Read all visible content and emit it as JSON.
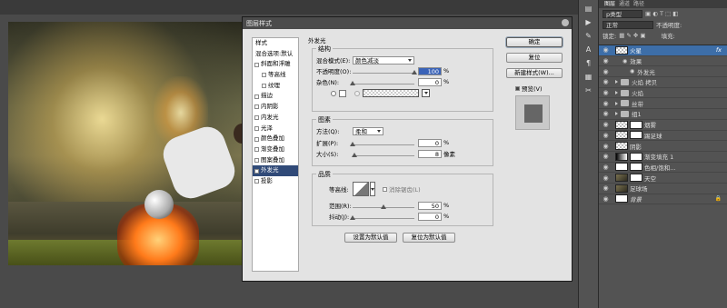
{
  "dialog": {
    "title": "图层样式",
    "styles_list": [
      {
        "label": "样式",
        "kind": "hdr"
      },
      {
        "label": "混合选项:默认",
        "kind": "hdr"
      },
      {
        "label": "斜面和浮雕",
        "kind": "cb"
      },
      {
        "label": "等高线",
        "kind": "sub"
      },
      {
        "label": "纹理",
        "kind": "sub"
      },
      {
        "label": "描边",
        "kind": "cb"
      },
      {
        "label": "内阴影",
        "kind": "cb"
      },
      {
        "label": "内发光",
        "kind": "cb"
      },
      {
        "label": "光泽",
        "kind": "cb"
      },
      {
        "label": "颜色叠加",
        "kind": "cb"
      },
      {
        "label": "渐变叠加",
        "kind": "cb"
      },
      {
        "label": "图案叠加",
        "kind": "cb"
      },
      {
        "label": "外发光",
        "kind": "sel"
      },
      {
        "label": "投影",
        "kind": "cb"
      }
    ],
    "outer_glow_title": "外发光",
    "structure": {
      "title": "结构",
      "blend_mode_label": "混合模式(E):",
      "blend_mode_value": "颜色减淡",
      "opacity_label": "不透明度(O):",
      "opacity_value": "100",
      "opacity_level": 1.0,
      "noise_label": "杂色(N):",
      "noise_value": "0",
      "noise_level": 0,
      "percent": "%"
    },
    "elements": {
      "title": "图素",
      "method_label": "方法(Q):",
      "method_value": "柔和",
      "spread_label": "扩展(P):",
      "spread_value": "0",
      "spread_level": 0,
      "size_label": "大小(S):",
      "size_value": "8",
      "size_level": 0.03,
      "percent": "%",
      "px_unit": "像素"
    },
    "quality": {
      "title": "品质",
      "contour_label": "等高线:",
      "antialias_label": "消除锯齿(L)",
      "range_label": "范围(R):",
      "range_value": "50",
      "range_level": 0.5,
      "jitter_label": "抖动(J):",
      "jitter_value": "0",
      "jitter_level": 0,
      "percent": "%"
    },
    "set_default": "设置为默认值",
    "reset_default": "复位为默认值",
    "ok": "确定",
    "reset": "复位",
    "new_style": "新建样式(W)...",
    "preview_label": "预览(V)"
  },
  "layers_panel": {
    "tabs": [
      "图层",
      "通道",
      "路径"
    ],
    "kind_label": "p类型",
    "blend": "正常",
    "opacity_label": "不透明度:",
    "lock_label": "锁定:",
    "fill_label": "填充:",
    "layers": [
      {
        "name": "火星",
        "thumb": "check",
        "selected": true,
        "fx": "fx"
      },
      {
        "name": "效果",
        "thumb": "",
        "indent": 1,
        "kind": "effects"
      },
      {
        "name": "外发光",
        "thumb": "",
        "indent": 2,
        "kind": "effect"
      },
      {
        "name": "火焰 拷贝",
        "kind": "folder"
      },
      {
        "name": "火焰",
        "kind": "folder"
      },
      {
        "name": "丝带",
        "kind": "folder"
      },
      {
        "name": "组1",
        "kind": "folder"
      },
      {
        "name": "烟雾",
        "thumb": "check",
        "mask": true
      },
      {
        "name": "踢足球",
        "thumb": "check",
        "mask": true
      },
      {
        "name": "阴影",
        "thumb": "check"
      },
      {
        "name": "渐变填充 1",
        "thumb": "grad",
        "mask": true
      },
      {
        "name": "色相/饱和...",
        "thumb": "white",
        "mask": true
      },
      {
        "name": "天空",
        "thumb": "photo",
        "mask": true
      },
      {
        "name": "足球场",
        "thumb": "photo"
      },
      {
        "name": "背景",
        "thumb": "white",
        "locked": true
      }
    ]
  }
}
